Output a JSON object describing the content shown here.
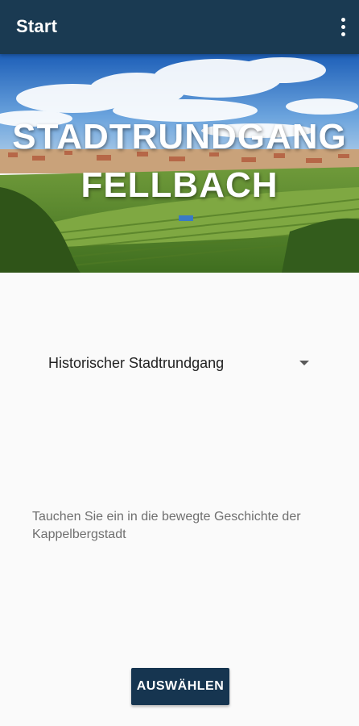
{
  "appbar": {
    "title": "Start",
    "menu_icon": "more-vert-icon"
  },
  "hero": {
    "title_line1": "STADTRUNDGANG",
    "title_line2": "FELLBACH"
  },
  "spinner": {
    "selected": "Historischer Stadtrundgang",
    "icon": "dropdown-arrow-icon"
  },
  "description": "Tauchen Sie ein in die bewegte Geschichte der Kappelbergstadt",
  "button": {
    "label": "AUSWÄHLEN"
  },
  "colors": {
    "primary": "#1a3a52",
    "button": "#163550",
    "background": "#fafafa"
  }
}
